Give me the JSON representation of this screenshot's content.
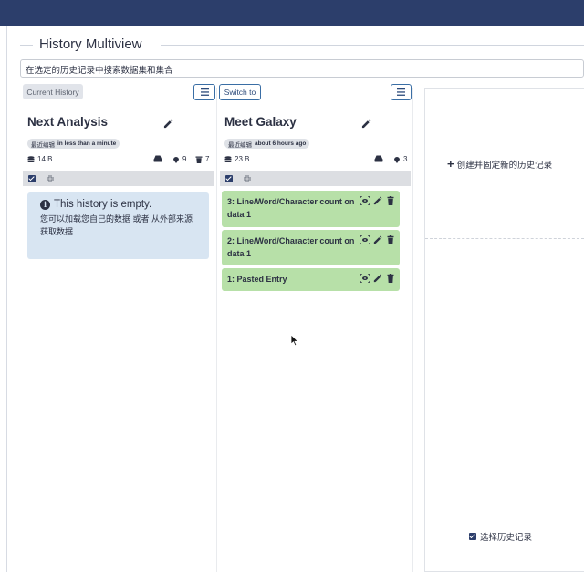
{
  "page": {
    "title": "History Multiview"
  },
  "search": {
    "value": "在选定的历史记录中搜索数据集和集合"
  },
  "toolbar": {
    "current_history": "Current History",
    "switch_to": "Switch to"
  },
  "histories": [
    {
      "name": "Next Analysis",
      "edited_label": "最近编辑",
      "edited_time": "in less than a minute",
      "size": "14 B",
      "hidden_count": "9",
      "deleted_count": "7",
      "empty": {
        "title": "This history is empty.",
        "text_1": "您可以加载您自己的数据",
        "text_or": " 或者 ",
        "text_2": "从外部来源获取数据",
        "text_end": "."
      }
    },
    {
      "name": "Meet Galaxy",
      "edited_label": "最近编辑",
      "edited_time": "about 6 hours ago",
      "size": "23 B",
      "hidden_count": "3",
      "datasets": [
        {
          "label": "3: Line/Word/Character count on data 1"
        },
        {
          "label": "2: Line/Word/Character count on data 1"
        },
        {
          "label": "1: Pasted Entry"
        }
      ]
    }
  ],
  "right_panel": {
    "create_pin": "创建并固定新的历史记录",
    "select_histories": "选择历史记录"
  },
  "colors": {
    "topbar": "#2c3e6b",
    "dataset_ok": "#b7e0a8",
    "info_bg": "#d8e5f2",
    "accent": "#3a6ea5"
  }
}
